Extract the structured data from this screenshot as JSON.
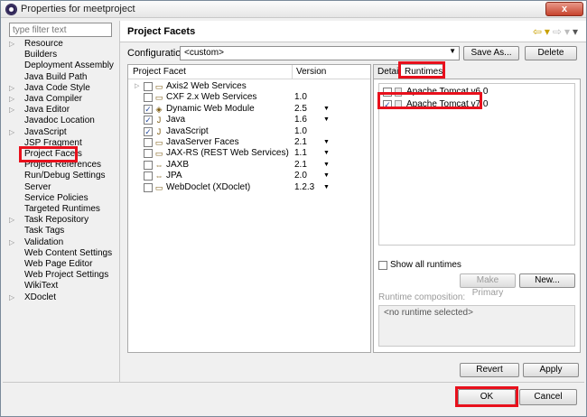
{
  "window": {
    "title": "Properties for meetproject",
    "close_label": "x"
  },
  "filter": {
    "placeholder": "type filter text"
  },
  "nav": {
    "items": [
      {
        "label": "Resource",
        "expandable": true
      },
      {
        "label": "Builders",
        "expandable": false
      },
      {
        "label": "Deployment Assembly",
        "expandable": false
      },
      {
        "label": "Java Build Path",
        "expandable": false
      },
      {
        "label": "Java Code Style",
        "expandable": true
      },
      {
        "label": "Java Compiler",
        "expandable": true
      },
      {
        "label": "Java Editor",
        "expandable": true
      },
      {
        "label": "Javadoc Location",
        "expandable": false
      },
      {
        "label": "JavaScript",
        "expandable": true
      },
      {
        "label": "JSP Fragment",
        "expandable": false
      },
      {
        "label": "Project Facets",
        "expandable": false
      },
      {
        "label": "Project References",
        "expandable": false
      },
      {
        "label": "Run/Debug Settings",
        "expandable": false
      },
      {
        "label": "Server",
        "expandable": false
      },
      {
        "label": "Service Policies",
        "expandable": false
      },
      {
        "label": "Targeted Runtimes",
        "expandable": false
      },
      {
        "label": "Task Repository",
        "expandable": true
      },
      {
        "label": "Task Tags",
        "expandable": false
      },
      {
        "label": "Validation",
        "expandable": true
      },
      {
        "label": "Web Content Settings",
        "expandable": false
      },
      {
        "label": "Web Page Editor",
        "expandable": false
      },
      {
        "label": "Web Project Settings",
        "expandable": false
      },
      {
        "label": "WikiText",
        "expandable": false
      },
      {
        "label": "XDoclet",
        "expandable": true
      }
    ],
    "selected": "Project Facets"
  },
  "header": {
    "title": "Project Facets"
  },
  "configuration": {
    "label": "Configuration:",
    "value": "<custom>",
    "save_as_label": "Save As...",
    "delete_label": "Delete"
  },
  "facets": {
    "col_facet": "Project Facet",
    "col_version": "Version",
    "rows": [
      {
        "name": "Axis2 Web Services",
        "version": "",
        "checked": false,
        "expandable": true,
        "has_dropdown": false,
        "icon": "folder-icon"
      },
      {
        "name": "CXF 2.x Web Services",
        "version": "1.0",
        "checked": false,
        "expandable": false,
        "has_dropdown": false,
        "icon": "folder-icon"
      },
      {
        "name": "Dynamic Web Module",
        "version": "2.5",
        "checked": true,
        "expandable": false,
        "has_dropdown": true,
        "icon": "web-module-icon"
      },
      {
        "name": "Java",
        "version": "1.6",
        "checked": true,
        "expandable": false,
        "has_dropdown": true,
        "icon": "java-icon"
      },
      {
        "name": "JavaScript",
        "version": "1.0",
        "checked": true,
        "expandable": false,
        "has_dropdown": false,
        "icon": "javascript-icon"
      },
      {
        "name": "JavaServer Faces",
        "version": "2.1",
        "checked": false,
        "expandable": false,
        "has_dropdown": true,
        "icon": "folder-icon"
      },
      {
        "name": "JAX-RS (REST Web Services)",
        "version": "1.1",
        "checked": false,
        "expandable": false,
        "has_dropdown": true,
        "icon": "folder-icon"
      },
      {
        "name": "JAXB",
        "version": "2.1",
        "checked": false,
        "expandable": false,
        "has_dropdown": true,
        "icon": "jaxb-icon"
      },
      {
        "name": "JPA",
        "version": "2.0",
        "checked": false,
        "expandable": false,
        "has_dropdown": true,
        "icon": "jpa-icon"
      },
      {
        "name": "WebDoclet (XDoclet)",
        "version": "1.2.3",
        "checked": false,
        "expandable": false,
        "has_dropdown": true,
        "icon": "folder-icon"
      }
    ]
  },
  "tabs": {
    "details": "Details",
    "runtimes": "Runtimes"
  },
  "runtimes": {
    "items": [
      {
        "label": "Apache Tomcat v6.0",
        "checked": false
      },
      {
        "label": "Apache Tomcat v7.0",
        "checked": true
      }
    ],
    "show_all_label": "Show all runtimes",
    "make_primary_label": "Make Primary",
    "new_label": "New...",
    "composition_label": "Runtime composition:",
    "composition_value": "<no runtime selected>"
  },
  "actions": {
    "revert": "Revert",
    "apply": "Apply",
    "ok": "OK",
    "cancel": "Cancel"
  },
  "colors": {
    "highlight": "#e8101c",
    "check": "#2b4fa0"
  }
}
